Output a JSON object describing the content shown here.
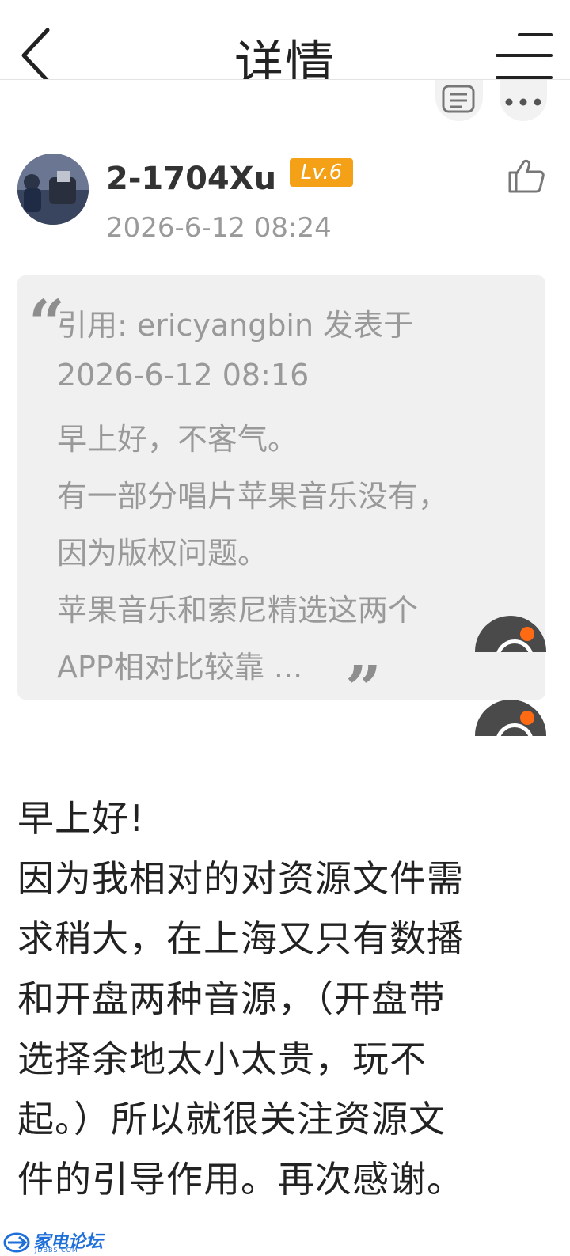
{
  "header": {
    "title": "详情"
  },
  "post": {
    "username": "2-1704Xu",
    "level": "Lv.6",
    "time": "2026-6-12 08:24",
    "quote": {
      "open_mark": "“",
      "close_mark": "”",
      "lines": [
        "引用: ericyangbin 发表于",
        "2026-6-12 08:16",
        "早上好，不客气。",
        "有一部分唱片苹果音乐没有，",
        "因为版权问题。",
        "苹果音乐和索尼精选这两个",
        "APP相对比较靠 ..."
      ]
    },
    "body_lines": [
      "早上好!",
      "因为我相对的对资源文件需",
      "求稍大，在上海又只有数播",
      "和开盘两种音源，（开盘带",
      "选择余地太小太贵，玩不",
      "起。）所以就很关注资源文",
      "件的引导作用。再次感谢。"
    ]
  },
  "watermark": {
    "text": "家电论坛",
    "domain": "JDBBS.COM"
  },
  "colors": {
    "level_badge": "#f4a118",
    "fab_dot": "#ff6a13",
    "quote_bg": "#f0f0f0",
    "watermark": "#1e6fd9"
  }
}
